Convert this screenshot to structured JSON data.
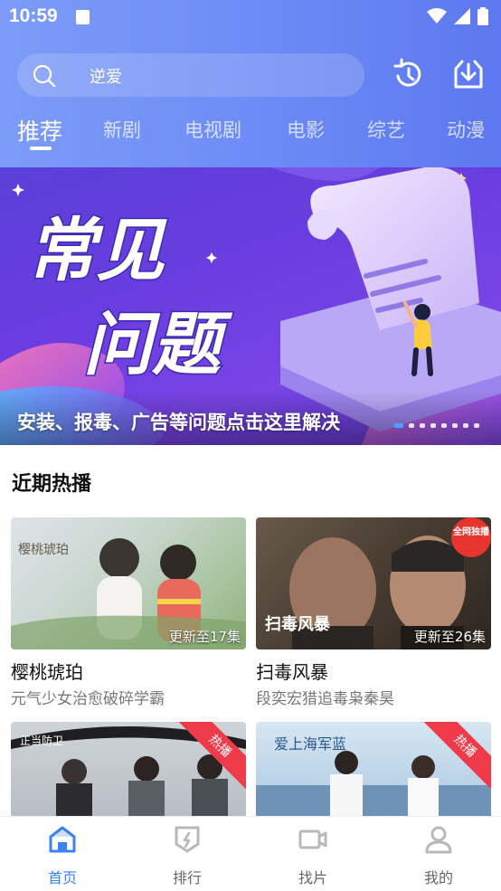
{
  "status_bar": {
    "time": "10:59"
  },
  "search": {
    "placeholder": "逆爱"
  },
  "tabs": [
    {
      "label": "推荐",
      "active": true
    },
    {
      "label": "新剧"
    },
    {
      "label": "电视剧"
    },
    {
      "label": "电影"
    },
    {
      "label": "综艺"
    },
    {
      "label": "动漫"
    }
  ],
  "banner": {
    "title_line1": "常见",
    "title_line2": "问题",
    "caption": "安装、报毒、广告等问题点击这里解决",
    "dot_count": 8,
    "active_dot": 0
  },
  "section": {
    "title": "近期热播"
  },
  "cards": [
    {
      "title": "樱桃琥珀",
      "subtitle": "元气少女治愈破碎学霸",
      "badge": "更新至17集",
      "thumb_art": "樱桃琥珀"
    },
    {
      "title": "扫毒风暴",
      "subtitle": "段奕宏猎追毒枭秦昊",
      "badge": "更新至26集",
      "thumb_art": "扫毒风暴",
      "corner_tag": "全网独播"
    },
    {
      "hot_tag": "热播",
      "thumb_art": "正当防卫"
    },
    {
      "hot_tag": "热播",
      "thumb_art": "爱上海军蓝"
    }
  ],
  "bottom_nav": [
    {
      "label": "首页",
      "icon": "home-icon",
      "active": true
    },
    {
      "label": "排行",
      "icon": "ranking-icon"
    },
    {
      "label": "找片",
      "icon": "video-camera-icon"
    },
    {
      "label": "我的",
      "icon": "user-icon"
    }
  ],
  "colors": {
    "header_start": "#7d9bf7",
    "header_end": "#5d78f0",
    "accent": "#3b82f6",
    "hot": "#ef3b49",
    "banner_purple": "#6a3de0"
  }
}
